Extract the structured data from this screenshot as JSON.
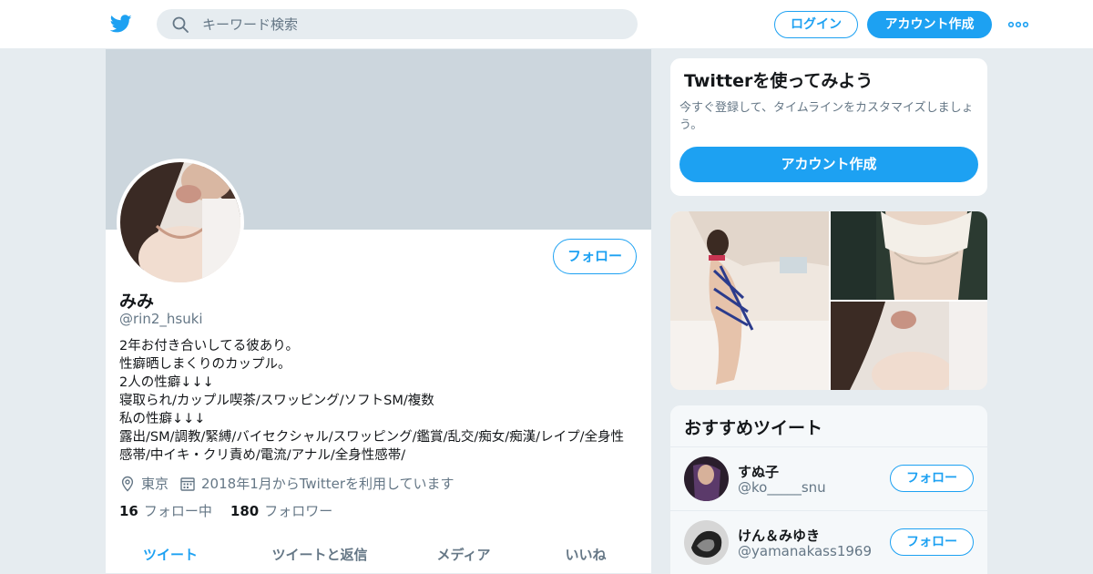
{
  "header": {
    "search_placeholder": "キーワード検索",
    "login_label": "ログイン",
    "signup_label": "アカウント作成"
  },
  "profile": {
    "follow_label": "フォロー",
    "name": "みみ",
    "handle": "@rin2_hsuki",
    "bio": [
      "2年お付き合いしてる彼あり。",
      "性癖晒しまくりのカップル。",
      "2人の性癖↓↓↓",
      "寝取られ/カップル喫茶/スワッピング/ソフトSM/複数",
      "私の性癖↓↓↓",
      "露出/SM/調教/緊縛/バイセクシャル/スワッピング/鑑賞/乱交/痴女/痴漢/レイプ/全身性",
      "感帯/中イキ・クリ責め/電流/アナル/全身性感帯/"
    ],
    "location": "東京",
    "joined": "2018年1月からTwitterを利用しています",
    "following_count": "16",
    "following_label": "フォロー中",
    "followers_count": "180",
    "followers_label": "フォロワー",
    "tabs": [
      "ツイート",
      "ツイートと返信",
      "メディア",
      "いいね"
    ],
    "active_tab": "ツイート"
  },
  "sidebar": {
    "try_title": "Twitterを使ってみよう",
    "try_text": "今すぐ登録して、タイムラインをカスタマイズしましょう。",
    "try_button": "アカウント作成",
    "recommend_title": "おすすめツイート",
    "recommend": [
      {
        "name": "すぬ子",
        "handle": "@ko_____snu",
        "follow_label": "フォロー"
      },
      {
        "name": "けん＆みゆき",
        "handle": "@yamanakass1969",
        "follow_label": "フォロー"
      }
    ]
  },
  "colors": {
    "accent": "#1da1f2",
    "banner": "#ccd6dd",
    "muted": "#657786"
  }
}
